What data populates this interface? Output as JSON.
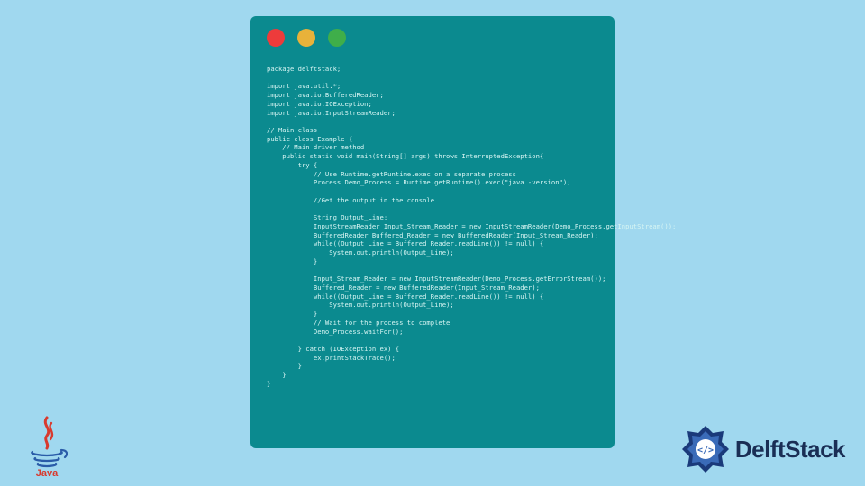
{
  "code": {
    "lines": [
      "package delftstack;",
      "",
      "import java.util.*;",
      "import java.io.BufferedReader;",
      "import java.io.IOException;",
      "import java.io.InputStreamReader;",
      "",
      "// Main class",
      "public class Example {",
      "    // Main driver method",
      "    public static void main(String[] args) throws InterruptedException{",
      "        try {",
      "            // Use Runtime.getRuntime.exec on a separate process",
      "            Process Demo_Process = Runtime.getRuntime().exec(\"java -version\");",
      "",
      "            //Get the output in the console",
      "",
      "            String Output_Line;",
      "            InputStreamReader Input_Stream_Reader = new InputStreamReader(Demo_Process.getInputStream());",
      "            BufferedReader Buffered_Reader = new BufferedReader(Input_Stream_Reader);",
      "            while((Output_Line = Buffered_Reader.readLine()) != null) {",
      "                System.out.println(Output_Line);",
      "            }",
      "",
      "            Input_Stream_Reader = new InputStreamReader(Demo_Process.getErrorStream());",
      "            Buffered_Reader = new BufferedReader(Input_Stream_Reader);",
      "            while((Output_Line = Buffered_Reader.readLine()) != null) {",
      "                System.out.println(Output_Line);",
      "            }",
      "            // Wait for the process to complete",
      "            Demo_Process.waitFor();",
      "",
      "        } catch (IOException ex) {",
      "            ex.printStackTrace();",
      "        }",
      "    }",
      "}"
    ]
  },
  "branding": {
    "site_name": "DelftStack"
  }
}
